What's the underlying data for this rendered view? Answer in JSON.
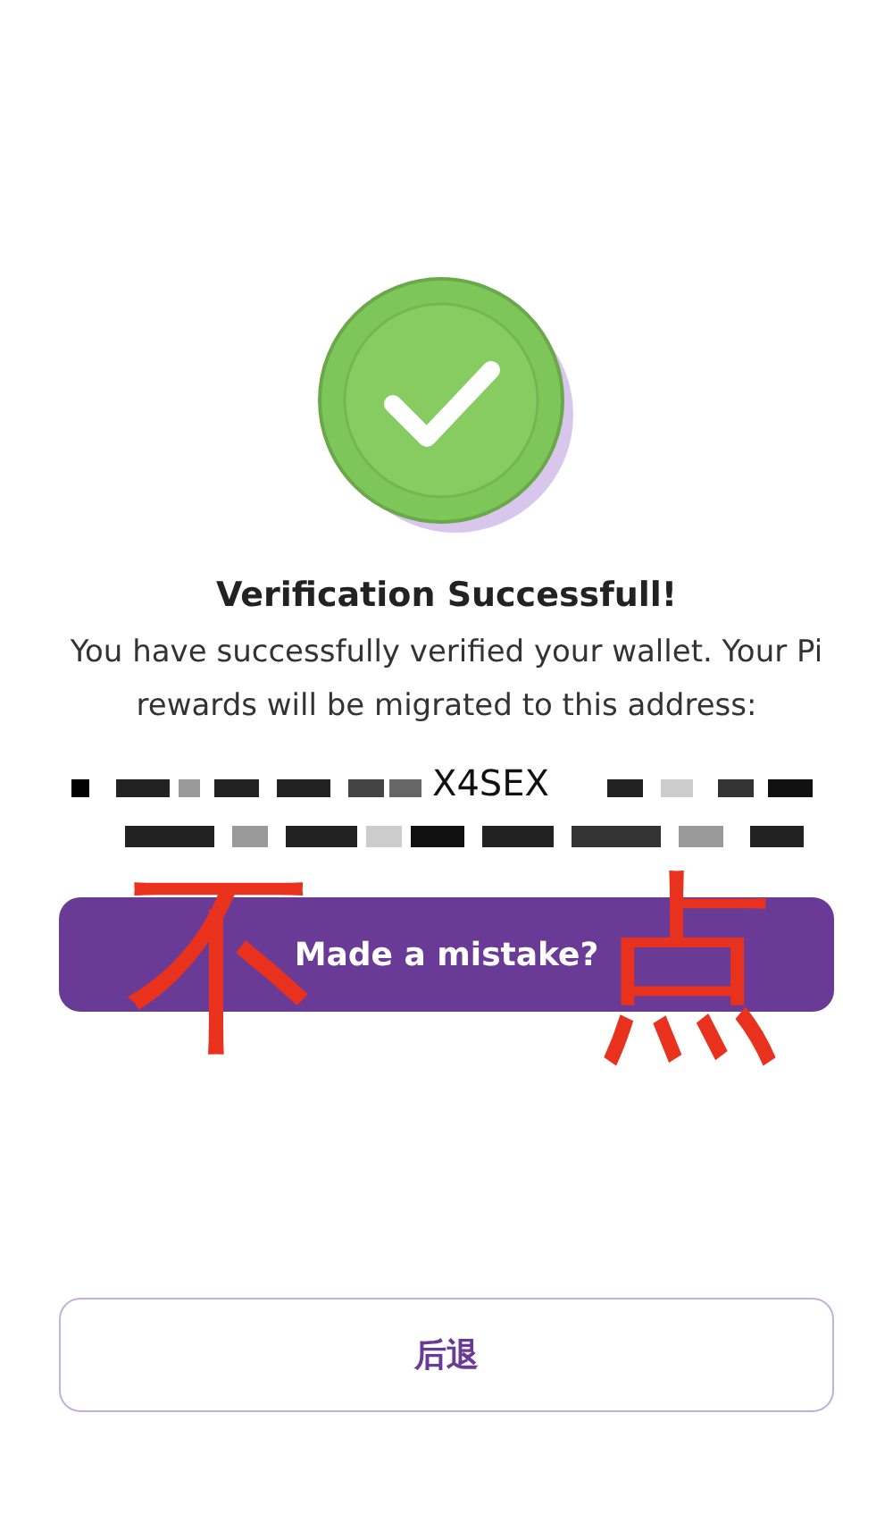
{
  "status": {
    "title": "Verification Successfull!",
    "message": "You have successfully verified your wallet. Your Pi rewards will be migrated to this address:"
  },
  "address": {
    "visible_part": "X4SEX"
  },
  "buttons": [
    {
      "label": "Made a mistake?",
      "kind": "filled"
    },
    {
      "label": "后退",
      "kind": "outlined"
    }
  ],
  "annotation": {
    "left": "不",
    "right": "点"
  }
}
